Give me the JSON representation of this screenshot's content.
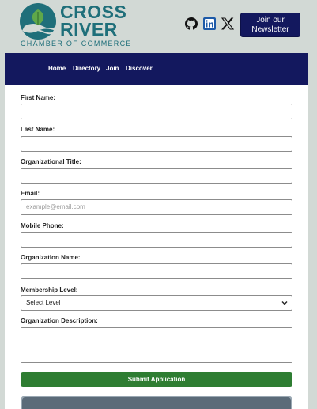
{
  "brand": {
    "name_line1": "CROSS",
    "name_line2": "RIVER",
    "tagline": "CHAMBER OF COMMERCE",
    "colors": {
      "teal": "#1f6f7a",
      "navy": "#13185e",
      "green": "#2e7d32",
      "leaf": "#5fa84a"
    }
  },
  "header": {
    "social": [
      "github-icon",
      "linkedin-icon",
      "x-icon"
    ],
    "newsletter_label": "Join our Newsletter"
  },
  "nav": {
    "items": [
      "Home",
      "Directory",
      "Join",
      "Discover"
    ]
  },
  "form": {
    "fields": [
      {
        "label": "First Name:",
        "value": ""
      },
      {
        "label": "Last Name:",
        "value": ""
      },
      {
        "label": "Organizational Title:",
        "value": ""
      },
      {
        "label": "Email:",
        "value": "",
        "placeholder": "example@email.com"
      },
      {
        "label": "Mobile Phone:",
        "value": ""
      },
      {
        "label": "Organization Name:",
        "value": ""
      },
      {
        "label": "Membership Level:",
        "selected": "Select Level"
      },
      {
        "label": "Organization Description:",
        "value": ""
      }
    ],
    "submit_label": "Submit Application"
  }
}
